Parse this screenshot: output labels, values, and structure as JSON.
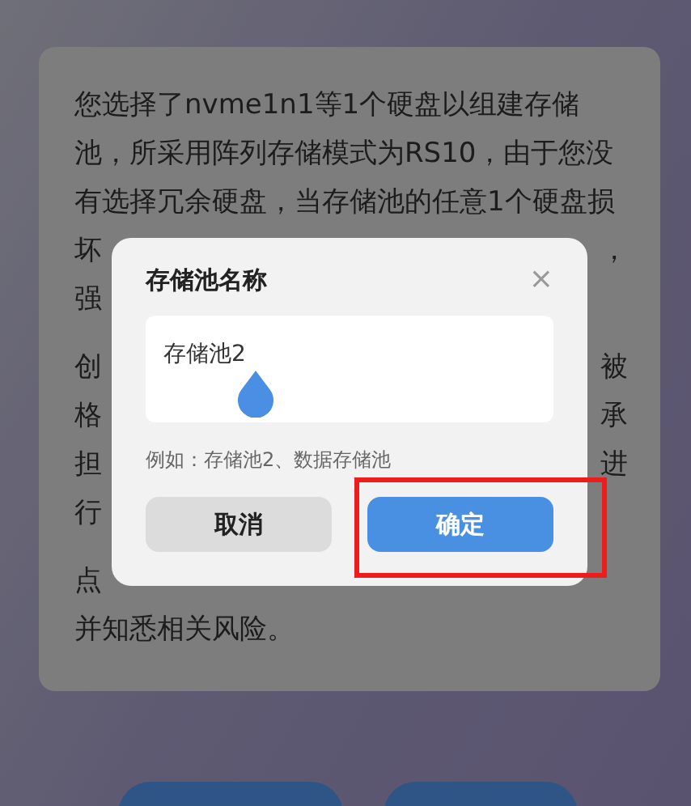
{
  "notice": {
    "paragraphs": [
      {
        "lines": [
          {
            "left": "您选择了nvme1n1等1个硬盘以组建存储"
          },
          {
            "left": "池，所采用阵列存储模式为RS10，由于您没"
          },
          {
            "left": "有选择冗余硬盘，当存储池的任意1个硬盘损"
          },
          {
            "left": "坏",
            "right": "，"
          },
          {
            "left": "强"
          }
        ]
      },
      {
        "lines": [
          {
            "left": "创",
            "right": "被"
          },
          {
            "left": "格",
            "right": "承"
          },
          {
            "left": "担",
            "right": "进"
          },
          {
            "left": "行"
          }
        ]
      },
      {
        "lines": [
          {
            "left": "点"
          },
          {
            "left": "并知悉相关风险。"
          }
        ]
      }
    ]
  },
  "dialog": {
    "title": "存储池名称",
    "close": "×",
    "input": {
      "value": "存储池2"
    },
    "hint": "例如：存储池2、数据存储池",
    "buttons": [
      {
        "label": "取消",
        "kind": "secondary"
      },
      {
        "label": "确定",
        "kind": "primary",
        "highlighted": true
      }
    ]
  }
}
